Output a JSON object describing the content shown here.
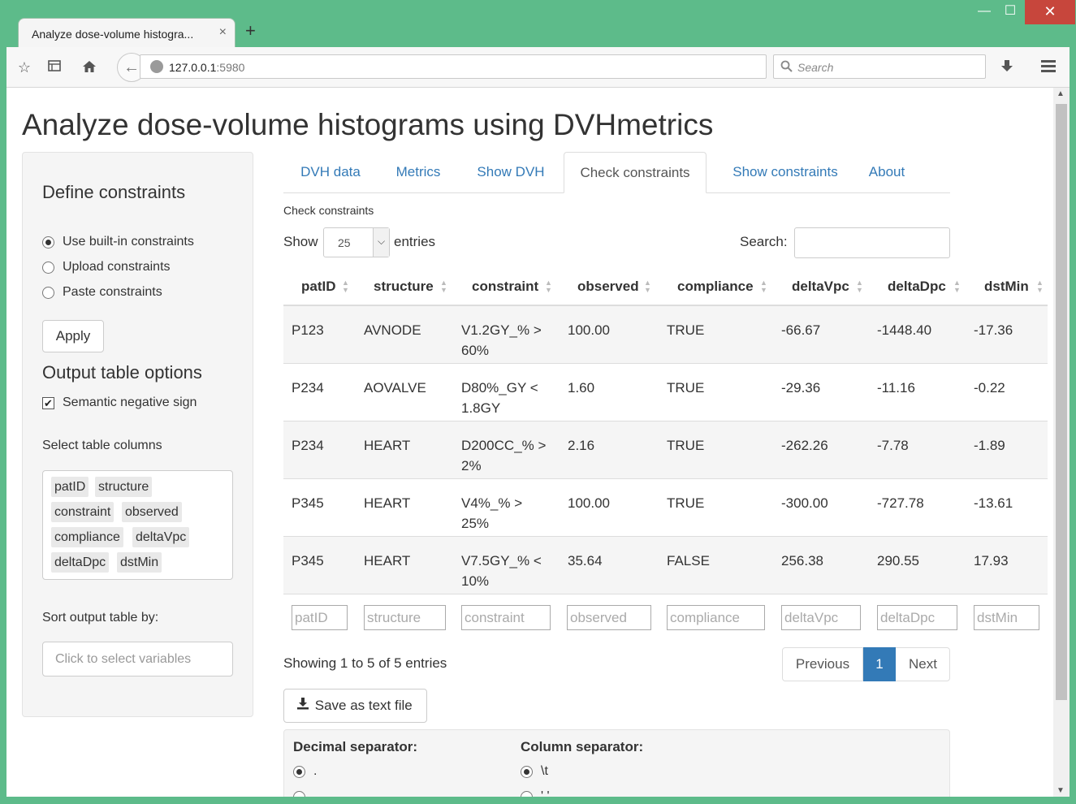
{
  "browser": {
    "tab_title": "Analyze dose-volume histogra...",
    "tab_close": "×",
    "new_tab": "+",
    "url_host": "127.0.0.1",
    "url_port": ":5980",
    "search_placeholder": "Search",
    "back_arrow": "←",
    "win_min": "—",
    "win_max": "☐",
    "win_close": "✕",
    "icons": [
      "star-icon",
      "reading-list-icon",
      "home-icon",
      "download-icon",
      "menu-icon"
    ]
  },
  "page": {
    "title": "Analyze dose-volume histograms using DVHmetrics"
  },
  "sidebar": {
    "heading": "Define constraints",
    "radios": [
      {
        "label": "Use built-in constraints",
        "checked": true
      },
      {
        "label": "Upload constraints",
        "checked": false
      },
      {
        "label": "Paste constraints",
        "checked": false
      }
    ],
    "apply_label": "Apply",
    "output_heading": "Output table options",
    "semantic_label": "Semantic negative sign",
    "semantic_checked": true,
    "select_columns_label": "Select table columns",
    "columns": [
      "patID",
      "structure",
      "constraint",
      "observed",
      "compliance",
      "deltaVpc",
      "deltaDpc",
      "dstMin"
    ],
    "sort_label": "Sort output table by:",
    "sort_placeholder": "Click to select variables"
  },
  "tabs": [
    {
      "label": "DVH data",
      "active": false
    },
    {
      "label": "Metrics",
      "active": false
    },
    {
      "label": "Show DVH",
      "active": false
    },
    {
      "label": "Check constraints",
      "active": true
    },
    {
      "label": "Show constraints",
      "active": false
    },
    {
      "label": "About",
      "active": false
    }
  ],
  "content": {
    "section_label": "Check constraints",
    "show_label": "Show",
    "page_length": "25",
    "entries_label": "entries",
    "search_label": "Search:",
    "table": {
      "headers": [
        "patID",
        "structure",
        "constraint",
        "observed",
        "compliance",
        "deltaVpc",
        "deltaDpc",
        "dstMin"
      ],
      "rows": [
        {
          "patID": "P123",
          "structure": "AVNODE",
          "constraint": [
            "V1.2GY_% >",
            "60%"
          ],
          "observed": "100.00",
          "compliance": "TRUE",
          "deltaVpc": "-66.67",
          "deltaDpc": "-1448.40",
          "dstMin": "-17.36"
        },
        {
          "patID": "P234",
          "structure": "AOVALVE",
          "constraint": [
            "D80%_GY <",
            "1.8GY"
          ],
          "observed": "1.60",
          "compliance": "TRUE",
          "deltaVpc": "-29.36",
          "deltaDpc": "-11.16",
          "dstMin": "-0.22"
        },
        {
          "patID": "P234",
          "structure": "HEART",
          "constraint": [
            "D200CC_% >",
            "2%"
          ],
          "observed": "2.16",
          "compliance": "TRUE",
          "deltaVpc": "-262.26",
          "deltaDpc": "-7.78",
          "dstMin": "-1.89"
        },
        {
          "patID": "P345",
          "structure": "HEART",
          "constraint": [
            "V4%_% >",
            "25%"
          ],
          "observed": "100.00",
          "compliance": "TRUE",
          "deltaVpc": "-300.00",
          "deltaDpc": "-727.78",
          "dstMin": "-13.61"
        },
        {
          "patID": "P345",
          "structure": "HEART",
          "constraint": [
            "V7.5GY_% <",
            "10%"
          ],
          "observed": "35.64",
          "compliance": "FALSE",
          "deltaVpc": "256.38",
          "deltaDpc": "290.55",
          "dstMin": "17.93"
        }
      ],
      "filter_placeholders": [
        "patID",
        "structure",
        "constraint",
        "observed",
        "compliance",
        "deltaVpc",
        "deltaDpc",
        "dstMin"
      ]
    },
    "info": "Showing 1 to 5 of 5 entries",
    "pager": {
      "previous": "Previous",
      "current": "1",
      "next": "Next"
    },
    "save_label": "Save as text file",
    "decimal_heading": "Decimal separator:",
    "decimal_options": [
      ".",
      ","
    ],
    "column_heading": "Column separator:",
    "column_options": [
      "\\t",
      "' '"
    ]
  },
  "colors": {
    "frame": "#5dbb8a",
    "link": "#337ab7",
    "active_page": "#337ab7"
  }
}
